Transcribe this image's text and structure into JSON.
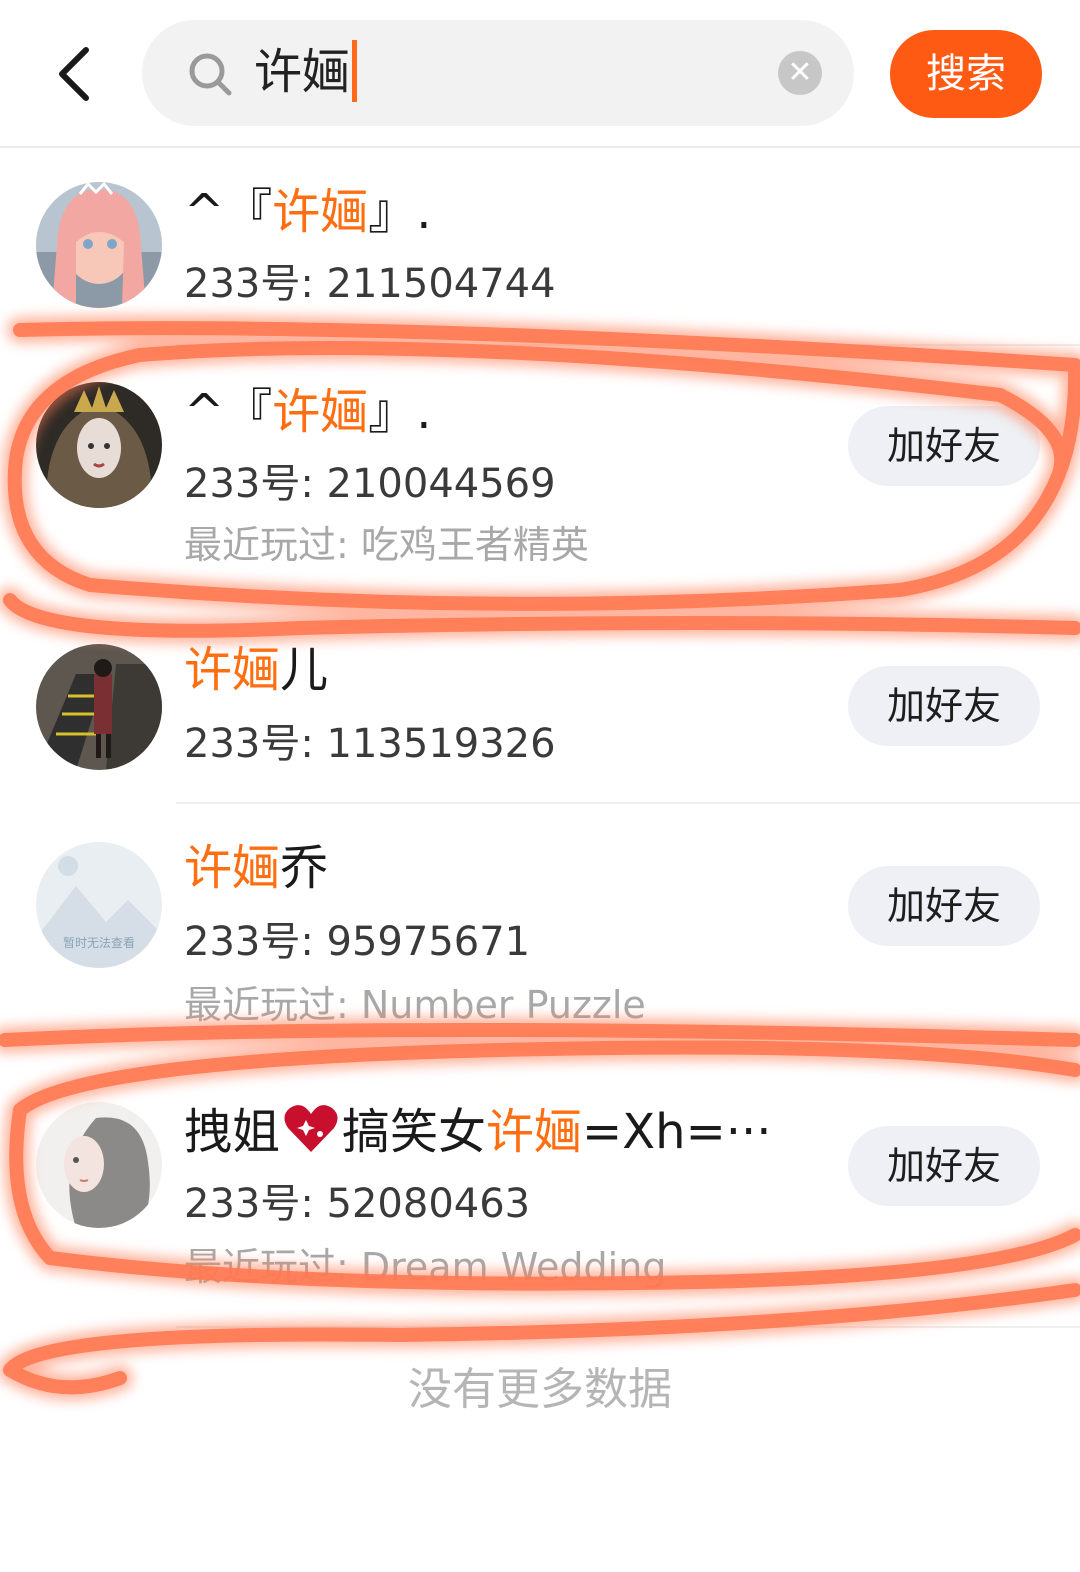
{
  "search": {
    "query": "许婳",
    "button_label": "搜索"
  },
  "colors": {
    "accent": "#ff5a14",
    "highlight": "#ff6e10",
    "marker": "#ff7a52"
  },
  "results": [
    {
      "name_prefix": "^『",
      "name_hl": "许婳",
      "name_suffix": "』.",
      "id": "233号: 211504744",
      "played": "",
      "add_label": ""
    },
    {
      "name_prefix": "^『",
      "name_hl": "许婳",
      "name_suffix": "』.",
      "id": "233号: 210044569",
      "played": "最近玩过: 吃鸡王者精英",
      "add_label": "加好友"
    },
    {
      "name_prefix": "",
      "name_hl": "许婳",
      "name_suffix": "儿",
      "id": "233号: 113519326",
      "played": "",
      "add_label": "加好友"
    },
    {
      "name_prefix": "",
      "name_hl": "许婳",
      "name_suffix": "乔",
      "id": "233号: 95975671",
      "played": "最近玩过: Number Puzzle",
      "add_label": "加好友",
      "avatar_text": "暂时无法查看"
    },
    {
      "name_prefix": "拽姐",
      "name_mid": "搞笑女",
      "name_hl": "许婳",
      "name_suffix": "=Xh=···",
      "id": "233号: 52080463",
      "played": "最近玩过: Dream Wedding",
      "add_label": "加好友"
    }
  ],
  "footer": {
    "no_more": "没有更多数据"
  }
}
